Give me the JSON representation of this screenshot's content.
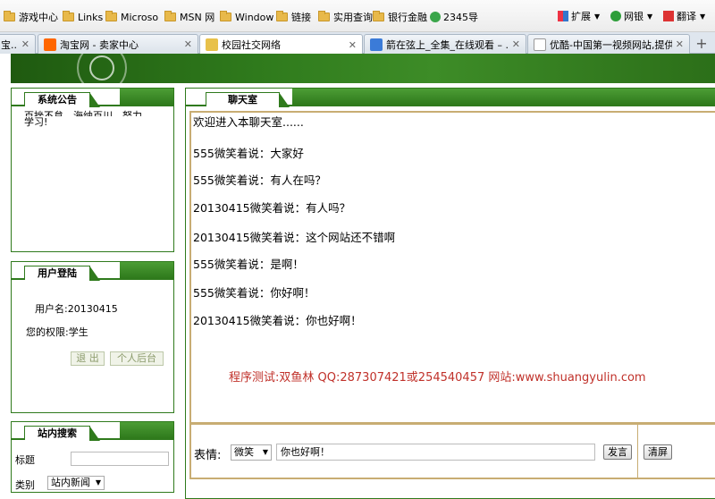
{
  "bookmarks": {
    "items": [
      "游戏中心",
      "Links",
      "Microso",
      "MSN 网",
      "Window",
      "链接",
      "实用查询",
      "银行金融",
      "2345导"
    ],
    "right": [
      "扩展",
      "网银",
      "翻译"
    ]
  },
  "tabs": [
    {
      "label": "宝..."
    },
    {
      "label": "淘宝网 - 卖家中心"
    },
    {
      "label": "校园社交网络"
    },
    {
      "label": "箭在弦上_全集_在线观看 – ..."
    },
    {
      "label": "优酷-中国第一视频网站,提供..."
    }
  ],
  "notice": {
    "title": "系统公告",
    "text_line1": "百挫不怠，海纳百川，努力",
    "text_line2": "学习!"
  },
  "login": {
    "title": "用户登陆",
    "username_label": "用户名:20130415",
    "role_label": "您的权限:学生",
    "logout_label": "退 出",
    "backend_label": "个人后台"
  },
  "search": {
    "title": "站内搜索",
    "field_label": "标题",
    "category_label": "类别",
    "category_value": "站内新闻"
  },
  "chat": {
    "title": "聊天室",
    "messages": [
      "欢迎进入本聊天室......",
      "555微笑着说：大家好",
      "555微笑着说：有人在吗？",
      "20130415微笑着说：有人吗？",
      "20130415微笑着说：这个网站还不错啊",
      "555微笑着说：是啊！",
      "555微笑着说：你好啊！",
      "20130415微笑着说：你也好啊！"
    ],
    "credit": "程序测试:双鱼林 QQ:287307421或254540457 网站:www.shuangyulin.com",
    "emotion_label": "表情:",
    "emotion_value": "微笑",
    "input_value": "你也好啊！",
    "send_label": "发言",
    "clear_label": "清屏"
  },
  "colors": {
    "brand_green": "#2f7a1c",
    "credit_red": "#c0312a",
    "chat_border": "#c8ad73"
  }
}
